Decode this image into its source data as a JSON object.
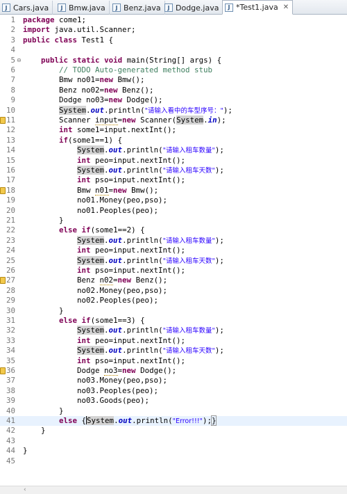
{
  "tabs": [
    {
      "label": "Cars.java",
      "icon": "java-file-icon"
    },
    {
      "label": "Bmw.java",
      "icon": "java-file-icon"
    },
    {
      "label": "Benz.java",
      "icon": "java-file-icon"
    },
    {
      "label": "Dodge.java",
      "icon": "java-file-icon"
    },
    {
      "label": "*Test1.java",
      "icon": "java-file-icon",
      "active": true,
      "close": "✕"
    }
  ],
  "editor": {
    "lines": [
      {
        "n": "1",
        "tokens": [
          [
            "kw",
            "package"
          ],
          [
            "t",
            " come1;"
          ]
        ]
      },
      {
        "n": "2",
        "tokens": [
          [
            "kw",
            "import"
          ],
          [
            "t",
            " java.util.Scanner;"
          ]
        ]
      },
      {
        "n": "3",
        "tokens": [
          [
            "kw",
            "public"
          ],
          [
            "t",
            " "
          ],
          [
            "kw",
            "class"
          ],
          [
            "t",
            " Test1 {"
          ]
        ]
      },
      {
        "n": "4",
        "tokens": []
      },
      {
        "n": "5",
        "fold": "⊖",
        "tokens": [
          [
            "t",
            "    "
          ],
          [
            "kw",
            "public"
          ],
          [
            "t",
            " "
          ],
          [
            "kw",
            "static"
          ],
          [
            "t",
            " "
          ],
          [
            "kw",
            "void"
          ],
          [
            "t",
            " main(String[] args) {"
          ]
        ]
      },
      {
        "n": "6",
        "tokens": [
          [
            "t",
            "        "
          ],
          [
            "cm",
            "// TODO Auto-generated method stub"
          ]
        ]
      },
      {
        "n": "7",
        "tokens": [
          [
            "t",
            "        Bmw no01="
          ],
          [
            "kw",
            "new"
          ],
          [
            "t",
            " Bmw();"
          ]
        ]
      },
      {
        "n": "8",
        "tokens": [
          [
            "t",
            "        Benz no02="
          ],
          [
            "kw",
            "new"
          ],
          [
            "t",
            " Benz();"
          ]
        ]
      },
      {
        "n": "9",
        "tokens": [
          [
            "t",
            "        Dodge no03="
          ],
          [
            "kw",
            "new"
          ],
          [
            "t",
            " Dodge();"
          ]
        ]
      },
      {
        "n": "10",
        "tokens": [
          [
            "t",
            "        "
          ],
          [
            "hl",
            "System"
          ],
          [
            "t",
            "."
          ],
          [
            "fd",
            "out"
          ],
          [
            "t",
            ".println("
          ],
          [
            "st",
            "\"请输入看中的车型序号：\""
          ],
          [
            "t",
            ");"
          ]
        ]
      },
      {
        "n": "11",
        "mark": true,
        "tokens": [
          [
            "t",
            "        Scanner "
          ],
          [
            "und",
            "input"
          ],
          [
            "t",
            "="
          ],
          [
            "kw",
            "new"
          ],
          [
            "t",
            " Scanner("
          ],
          [
            "hl",
            "System"
          ],
          [
            "t",
            "."
          ],
          [
            "fd",
            "in"
          ],
          [
            "t",
            ");"
          ]
        ]
      },
      {
        "n": "12",
        "tokens": [
          [
            "t",
            "        "
          ],
          [
            "kw",
            "int"
          ],
          [
            "t",
            " some1=input.nextInt();"
          ]
        ]
      },
      {
        "n": "13",
        "tokens": [
          [
            "t",
            "        "
          ],
          [
            "kw",
            "if"
          ],
          [
            "t",
            "(some1==1) {"
          ]
        ]
      },
      {
        "n": "14",
        "tokens": [
          [
            "t",
            "            "
          ],
          [
            "hl",
            "System"
          ],
          [
            "t",
            "."
          ],
          [
            "fd",
            "out"
          ],
          [
            "t",
            ".println("
          ],
          [
            "st",
            "\"请输入租车数量\""
          ],
          [
            "t",
            ");"
          ]
        ]
      },
      {
        "n": "15",
        "tokens": [
          [
            "t",
            "            "
          ],
          [
            "kw",
            "int"
          ],
          [
            "t",
            " peo=input.nextInt();"
          ]
        ]
      },
      {
        "n": "16",
        "tokens": [
          [
            "t",
            "            "
          ],
          [
            "hl",
            "System"
          ],
          [
            "t",
            "."
          ],
          [
            "fd",
            "out"
          ],
          [
            "t",
            ".println("
          ],
          [
            "st",
            "\"请输入租车天数\""
          ],
          [
            "t",
            ");"
          ]
        ]
      },
      {
        "n": "17",
        "tokens": [
          [
            "t",
            "            "
          ],
          [
            "kw",
            "int"
          ],
          [
            "t",
            " pso=input.nextInt();"
          ]
        ]
      },
      {
        "n": "18",
        "mark": true,
        "tokens": [
          [
            "t",
            "            Bmw "
          ],
          [
            "und",
            "n01"
          ],
          [
            "t",
            "="
          ],
          [
            "kw",
            "new"
          ],
          [
            "t",
            " Bmw();"
          ]
        ]
      },
      {
        "n": "19",
        "tokens": [
          [
            "t",
            "            no01.Money(peo,pso);"
          ]
        ]
      },
      {
        "n": "20",
        "tokens": [
          [
            "t",
            "            no01.Peoples(peo);"
          ]
        ]
      },
      {
        "n": "21",
        "tokens": [
          [
            "t",
            "        }"
          ]
        ]
      },
      {
        "n": "22",
        "tokens": [
          [
            "t",
            "        "
          ],
          [
            "kw",
            "else"
          ],
          [
            "t",
            " "
          ],
          [
            "kw",
            "if"
          ],
          [
            "t",
            "(some1==2) {"
          ]
        ]
      },
      {
        "n": "23",
        "tokens": [
          [
            "t",
            "            "
          ],
          [
            "hl",
            "System"
          ],
          [
            "t",
            "."
          ],
          [
            "fd",
            "out"
          ],
          [
            "t",
            ".println("
          ],
          [
            "st",
            "\"请输入租车数量\""
          ],
          [
            "t",
            ");"
          ]
        ]
      },
      {
        "n": "24",
        "tokens": [
          [
            "t",
            "            "
          ],
          [
            "kw",
            "int"
          ],
          [
            "t",
            " peo=input.nextInt();"
          ]
        ]
      },
      {
        "n": "25",
        "tokens": [
          [
            "t",
            "            "
          ],
          [
            "hl",
            "System"
          ],
          [
            "t",
            "."
          ],
          [
            "fd",
            "out"
          ],
          [
            "t",
            ".println("
          ],
          [
            "st",
            "\"请输入租车天数\""
          ],
          [
            "t",
            ");"
          ]
        ]
      },
      {
        "n": "26",
        "tokens": [
          [
            "t",
            "            "
          ],
          [
            "kw",
            "int"
          ],
          [
            "t",
            " pso=input.nextInt();"
          ]
        ]
      },
      {
        "n": "27",
        "mark": true,
        "tokens": [
          [
            "t",
            "            Benz "
          ],
          [
            "und",
            "n02"
          ],
          [
            "t",
            "="
          ],
          [
            "kw",
            "new"
          ],
          [
            "t",
            " Benz();"
          ]
        ]
      },
      {
        "n": "28",
        "tokens": [
          [
            "t",
            "            no02.Money(peo,pso);"
          ]
        ]
      },
      {
        "n": "29",
        "tokens": [
          [
            "t",
            "            no02.Peoples(peo);"
          ]
        ]
      },
      {
        "n": "30",
        "tokens": [
          [
            "t",
            "        }"
          ]
        ]
      },
      {
        "n": "31",
        "tokens": [
          [
            "t",
            "        "
          ],
          [
            "kw",
            "else"
          ],
          [
            "t",
            " "
          ],
          [
            "kw",
            "if"
          ],
          [
            "t",
            "(some1==3) {"
          ]
        ]
      },
      {
        "n": "32",
        "tokens": [
          [
            "t",
            "            "
          ],
          [
            "hl",
            "System"
          ],
          [
            "t",
            "."
          ],
          [
            "fd",
            "out"
          ],
          [
            "t",
            ".println("
          ],
          [
            "st",
            "\"请输入租车数量\""
          ],
          [
            "t",
            ");"
          ]
        ]
      },
      {
        "n": "33",
        "tokens": [
          [
            "t",
            "            "
          ],
          [
            "kw",
            "int"
          ],
          [
            "t",
            " peo=input.nextInt();"
          ]
        ]
      },
      {
        "n": "34",
        "tokens": [
          [
            "t",
            "            "
          ],
          [
            "hl",
            "System"
          ],
          [
            "t",
            "."
          ],
          [
            "fd",
            "out"
          ],
          [
            "t",
            ".println("
          ],
          [
            "st",
            "\"请输入租车天数\""
          ],
          [
            "t",
            ");"
          ]
        ]
      },
      {
        "n": "35",
        "tokens": [
          [
            "t",
            "            "
          ],
          [
            "kw",
            "int"
          ],
          [
            "t",
            " pso=input.nextInt();"
          ]
        ]
      },
      {
        "n": "36",
        "mark": true,
        "tokens": [
          [
            "t",
            "            Dodge "
          ],
          [
            "und",
            "no3"
          ],
          [
            "t",
            "="
          ],
          [
            "kw",
            "new"
          ],
          [
            "t",
            " Dodge();"
          ]
        ]
      },
      {
        "n": "37",
        "tokens": [
          [
            "t",
            "            no03.Money(peo,pso);"
          ]
        ]
      },
      {
        "n": "38",
        "tokens": [
          [
            "t",
            "            no03.Peoples(peo);"
          ]
        ]
      },
      {
        "n": "39",
        "tokens": [
          [
            "t",
            "            no03.Goods(peo);"
          ]
        ]
      },
      {
        "n": "40",
        "tokens": [
          [
            "t",
            "        }"
          ]
        ]
      },
      {
        "n": "41",
        "current": true,
        "tokens": [
          [
            "t",
            "        "
          ],
          [
            "kw",
            "else"
          ],
          [
            "t",
            " {"
          ],
          [
            "cursor",
            ""
          ],
          [
            "hl",
            "System"
          ],
          [
            "t",
            "."
          ],
          [
            "fd",
            "out"
          ],
          [
            "t",
            ".println("
          ],
          [
            "st",
            "\"Error!!!\""
          ],
          [
            "t",
            ");"
          ],
          [
            "br",
            "}"
          ]
        ]
      },
      {
        "n": "42",
        "tokens": [
          [
            "t",
            "    }"
          ]
        ]
      },
      {
        "n": "43",
        "tokens": []
      },
      {
        "n": "44",
        "tokens": [
          [
            "t",
            "}"
          ]
        ]
      },
      {
        "n": "45",
        "tokens": []
      }
    ]
  },
  "scrollbar": {
    "left_arrow": "‹"
  }
}
